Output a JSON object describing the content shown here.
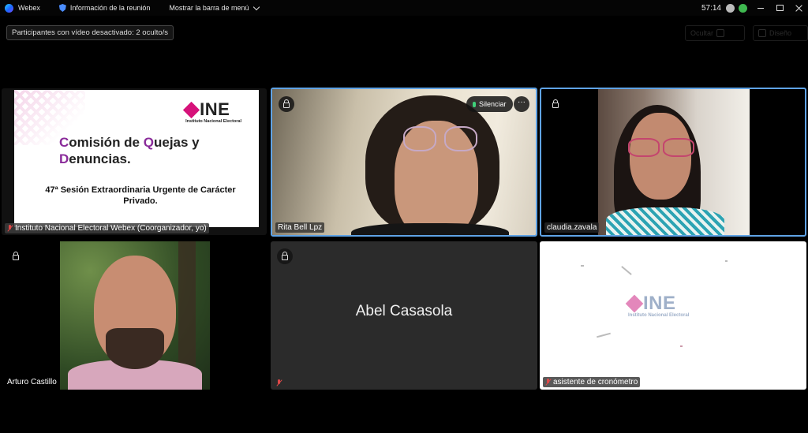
{
  "titlebar": {
    "app_name": "Webex",
    "meeting_info": "Información de la reunión",
    "menu_bar": "Mostrar la barra de menú",
    "timer": "57:14"
  },
  "top": {
    "hidden_participants": "Participantes con vídeo desactivado: 2 oculto/s",
    "layout_button": "Diseño",
    "ghost_button": "Ocultar"
  },
  "tiles": {
    "presentation": {
      "name": "Instituto Nacional Electoral Webex (Coorganizador, yo)",
      "slide": {
        "logo_text": "INE",
        "logo_sub": "Instituto Nacional Electoral",
        "title_c": "C",
        "title_1": "omisión de ",
        "title_q": "Q",
        "title_2": "uejas y",
        "title_d": "D",
        "title_3": "enuncias.",
        "subtitle": "47ª Sesión Extraordinaria Urgente de Carácter Privado."
      }
    },
    "rita": {
      "name": "Rita Bell Lpz",
      "silence_label": "Silenciar",
      "more_label": "···"
    },
    "claudia": {
      "name": "claudia.zavala"
    },
    "arturo": {
      "name": "Arturo Castillo"
    },
    "abel": {
      "name": "Abel Casasola"
    },
    "timer_assistant": {
      "name": "asistente de cronómetro",
      "logo_text": "INE",
      "logo_sub": "Instituto Nacional Electoral"
    }
  },
  "colors": {
    "active_border": "#5fa3e6",
    "ine_magenta": "#d6127a",
    "muted_red": "#e04848"
  }
}
